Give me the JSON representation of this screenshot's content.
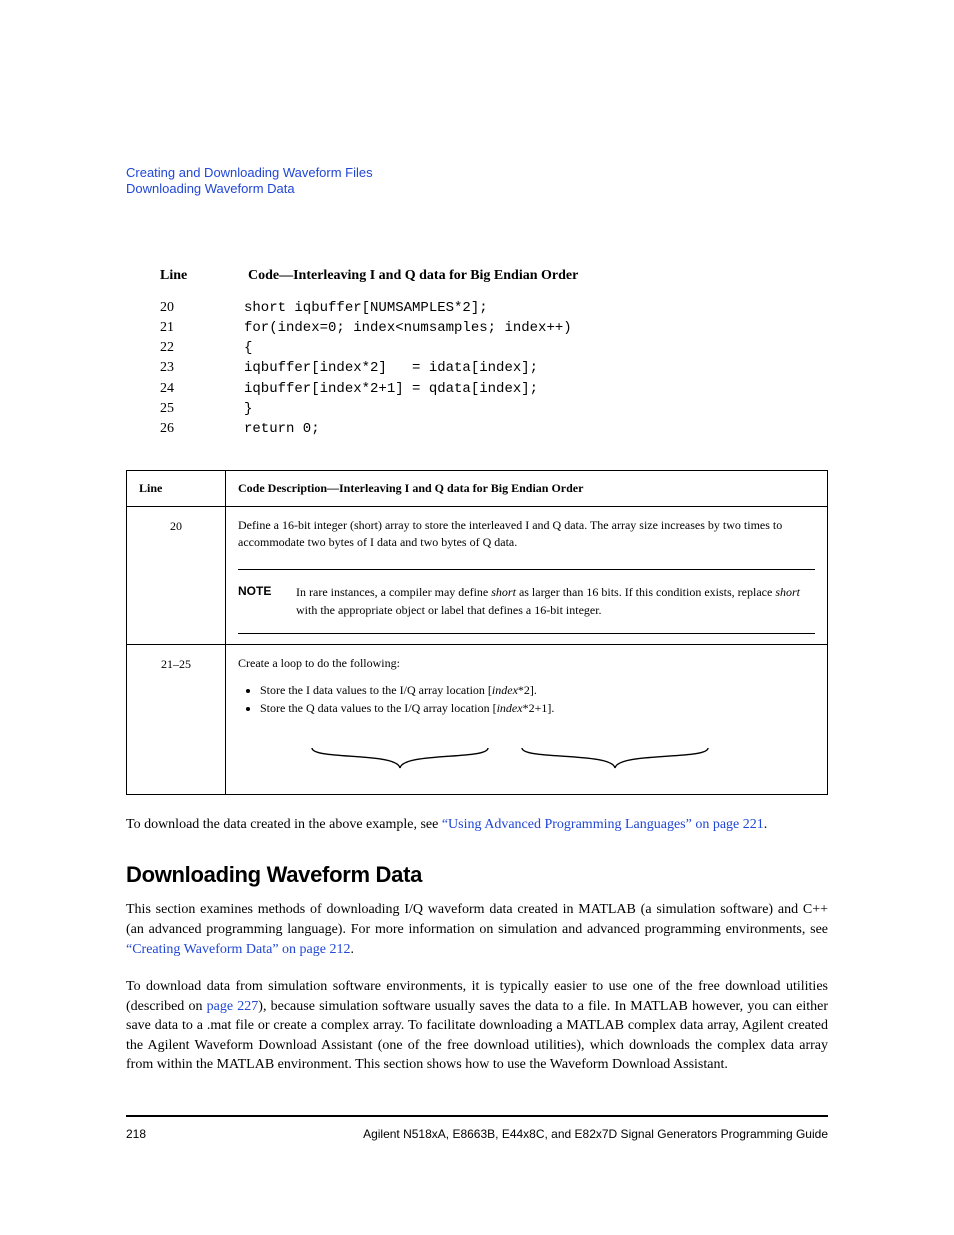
{
  "running_head": {
    "line1": "Creating and Downloading Waveform Files",
    "line2": "Downloading Waveform Data"
  },
  "code_header": {
    "line": "Line",
    "title": "Code—Interleaving I and Q data for Big Endian Order"
  },
  "code_lines": [
    {
      "n": "20",
      "c": "short iqbuffer[NUMSAMPLES*2];"
    },
    {
      "n": "21",
      "c": "for(index=0; index<numsamples; index++)"
    },
    {
      "n": "22",
      "c": "{"
    },
    {
      "n": "23",
      "c": "iqbuffer[index*2]   = idata[index];"
    },
    {
      "n": "24",
      "c": "iqbuffer[index*2+1] = qdata[index];"
    },
    {
      "n": "25",
      "c": "}"
    },
    {
      "n": "26",
      "c": "return 0;"
    }
  ],
  "table": {
    "head_line": "Line",
    "head_desc": "Code Description—Interleaving I and Q data for Big Endian Order",
    "row20": {
      "label": "20",
      "text": "Define a 16-bit integer (short) array to store the interleaved I and Q data. The array size increases by two times to accommodate two bytes of I data and two bytes of Q data.",
      "note_label": "NOTE",
      "note_a": "In rare instances, a compiler may define ",
      "note_em1": "short",
      "note_b": " as larger than 16 bits. If this condition exists, replace ",
      "note_em2": "short",
      "note_c": " with the appropriate object or label that defines a 16-bit integer."
    },
    "row21": {
      "label": "21–25",
      "lead": "Create a loop to do the following:",
      "b1a": "Store the I data values to the I/Q array location [",
      "b1em": "index",
      "b1b": "*2].",
      "b2a": "Store the Q data values to the I/Q array location [",
      "b2em": "index",
      "b2b": "*2+1]."
    }
  },
  "after_table": {
    "a": "To download the data created in the above example, see ",
    "link": "“Using Advanced Programming Languages” on page 221",
    "b": "."
  },
  "section_title": "Downloading Waveform Data",
  "para1": {
    "a": "This section examines methods of downloading I/Q waveform data created in MATLAB (a simulation software) and C++ (an advanced programming language). For more information on simulation and advanced programming environments, see ",
    "link": "“Creating Waveform Data” on page 212",
    "b": "."
  },
  "para2": {
    "a": "To download data from simulation software environments, it is typically easier to use one of the free download utilities (described on ",
    "link": "page 227",
    "b": "), because simulation software usually saves the data to a file. In MATLAB however, you can either save data to a .mat file or create a complex array. To facilitate downloading a MATLAB complex data array, Agilent created the Agilent Waveform Download Assistant (one of the free download utilities), which downloads the complex data array from within the MATLAB environment. This section shows how to use the Waveform Download Assistant."
  },
  "footer": {
    "page": "218",
    "right": "Agilent N518xA, E8663B, E44x8C, and E82x7D Signal Generators Programming Guide"
  }
}
